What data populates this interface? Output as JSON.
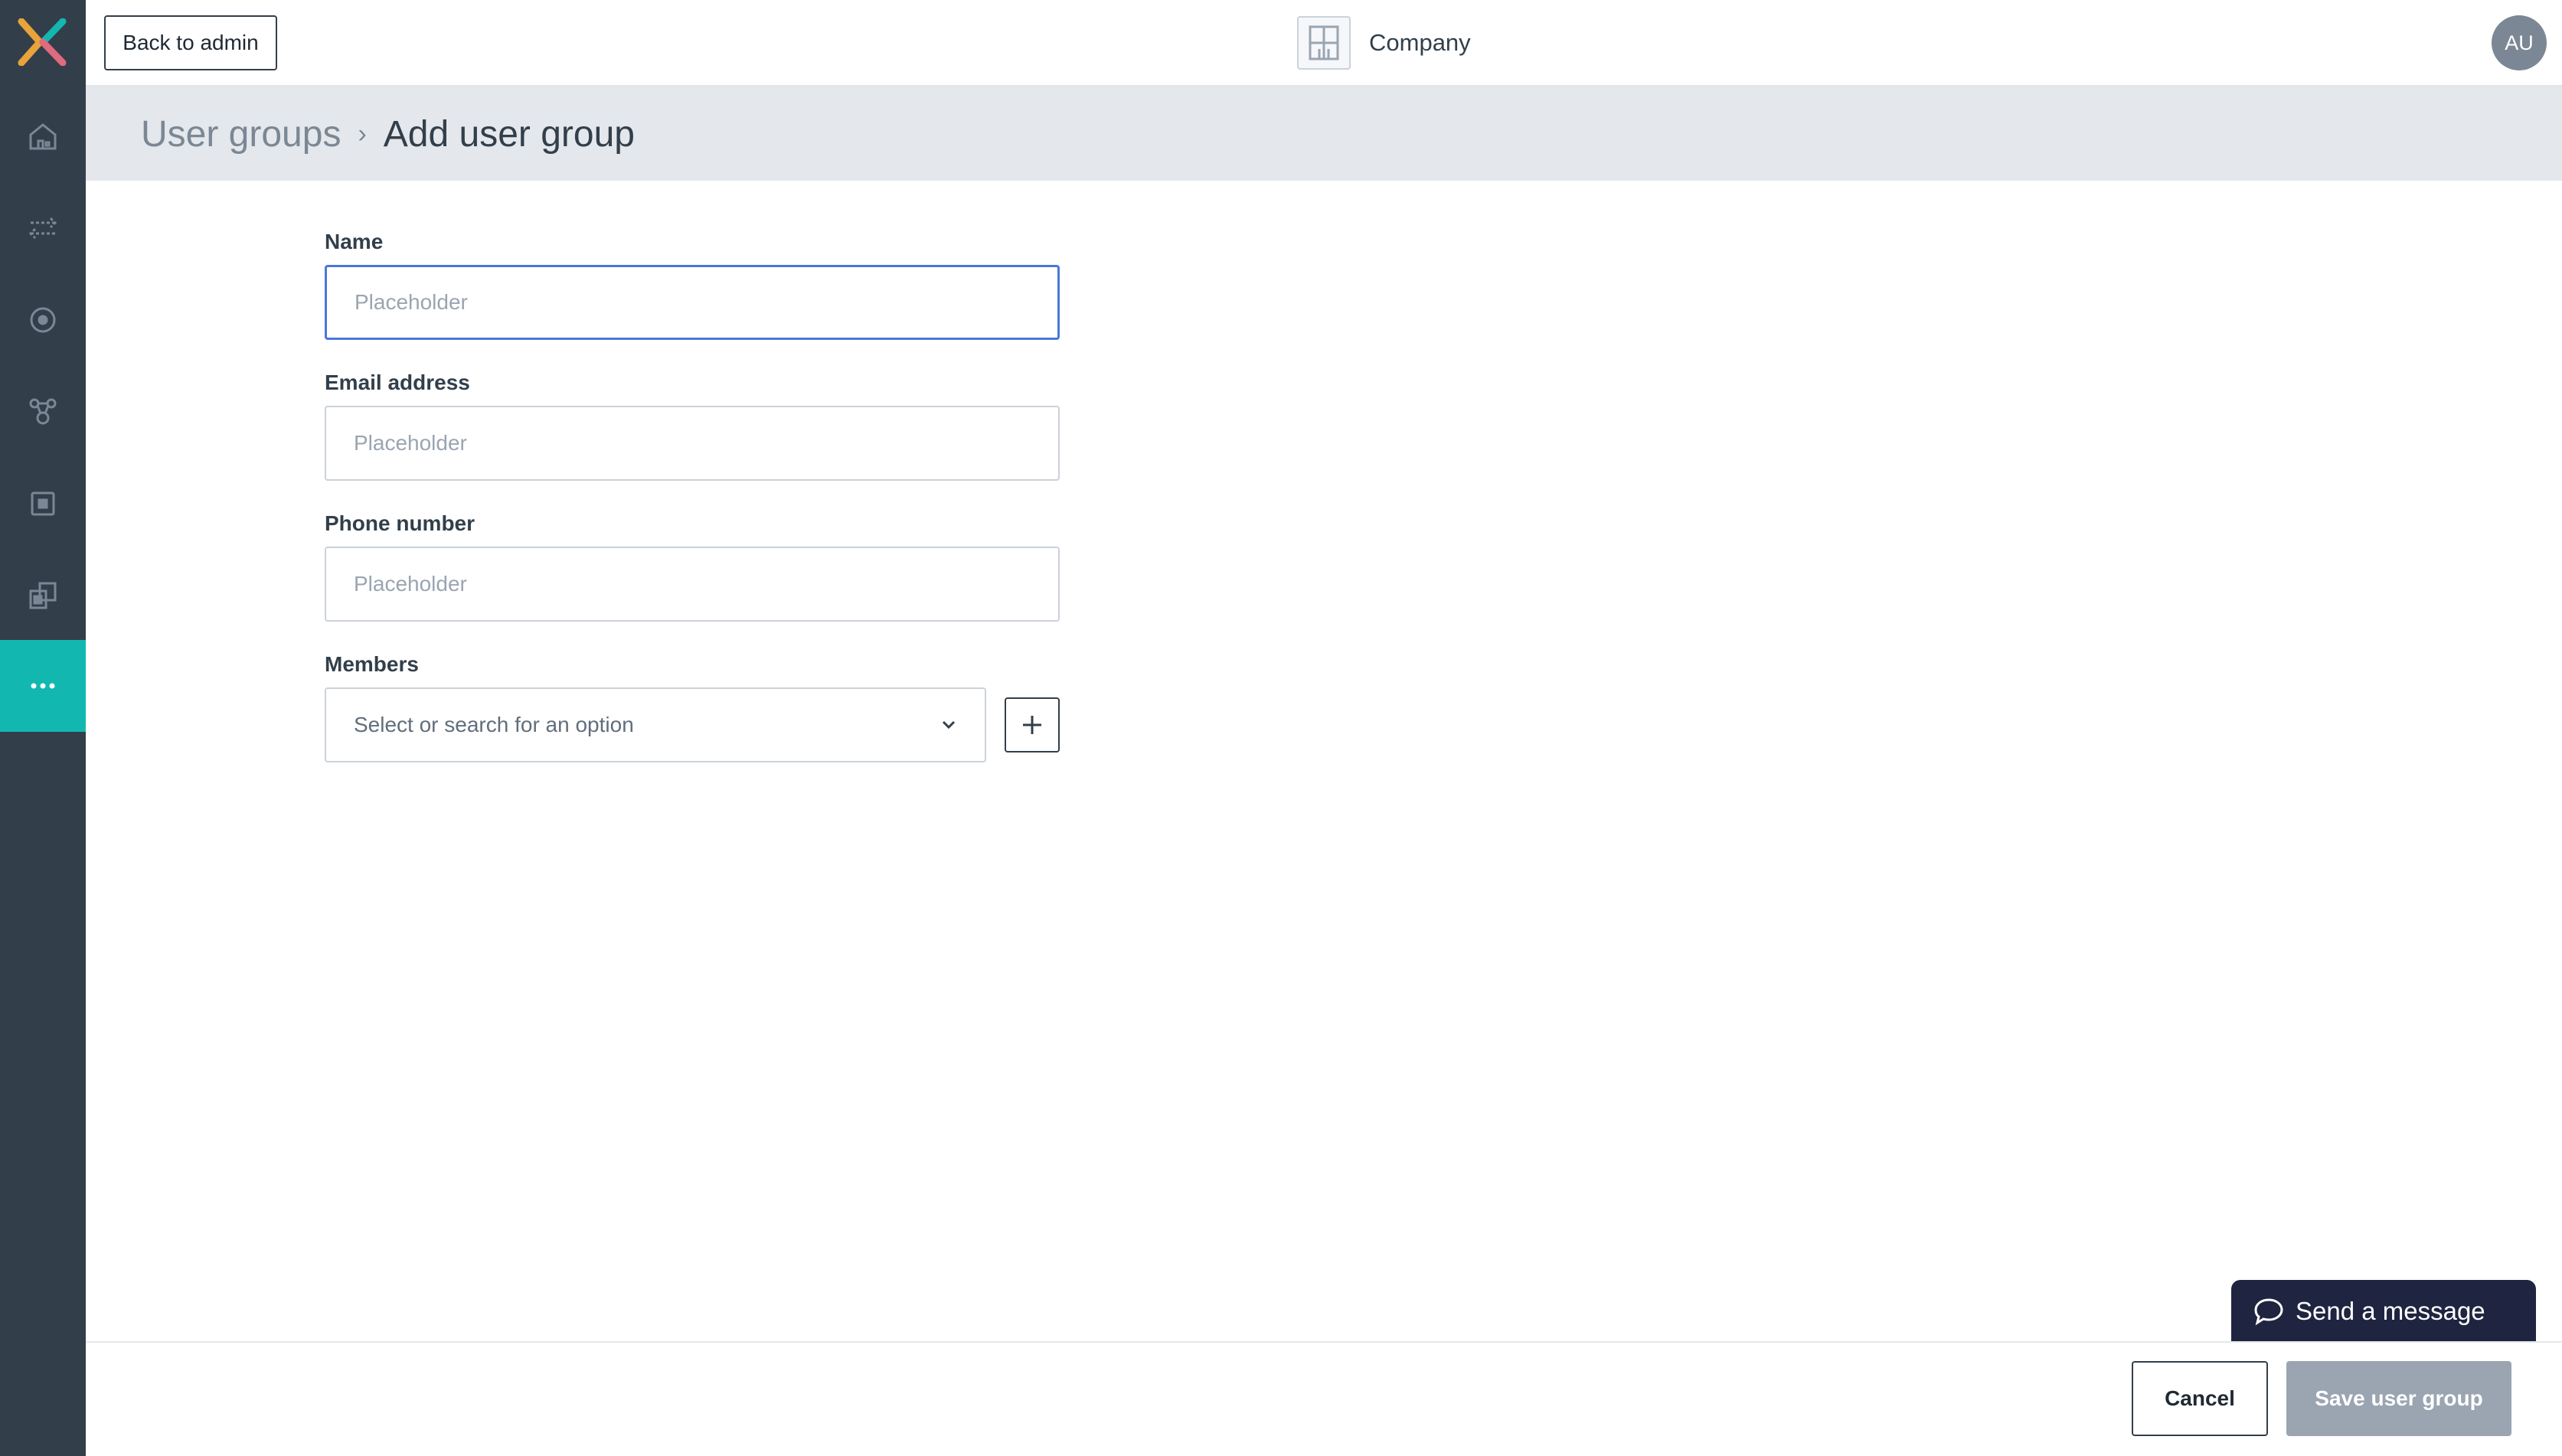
{
  "sidebar": {
    "logo": "brand-x-logo",
    "items": [
      {
        "icon": "home-icon"
      },
      {
        "icon": "transfer-icon"
      },
      {
        "icon": "target-icon"
      },
      {
        "icon": "network-icon"
      },
      {
        "icon": "box-icon"
      },
      {
        "icon": "documents-icon"
      },
      {
        "icon": "more-icon",
        "active": true
      }
    ],
    "active_color": "#12b8b0",
    "background": "#323f4b"
  },
  "topbar": {
    "back_label": "Back to admin",
    "company_name": "Company",
    "avatar_initials": "AU"
  },
  "breadcrumb": {
    "parent": "User groups",
    "separator": "›",
    "current": "Add user group"
  },
  "form": {
    "name": {
      "label": "Name",
      "placeholder": "Placeholder",
      "value": ""
    },
    "email": {
      "label": "Email address",
      "placeholder": "Placeholder",
      "value": ""
    },
    "phone": {
      "label": "Phone number",
      "placeholder": "Placeholder",
      "value": ""
    },
    "members": {
      "label": "Members",
      "placeholder": "Select or search for an option"
    }
  },
  "footer": {
    "cancel_label": "Cancel",
    "save_label": "Save user group"
  },
  "chat": {
    "label": "Send a message"
  }
}
